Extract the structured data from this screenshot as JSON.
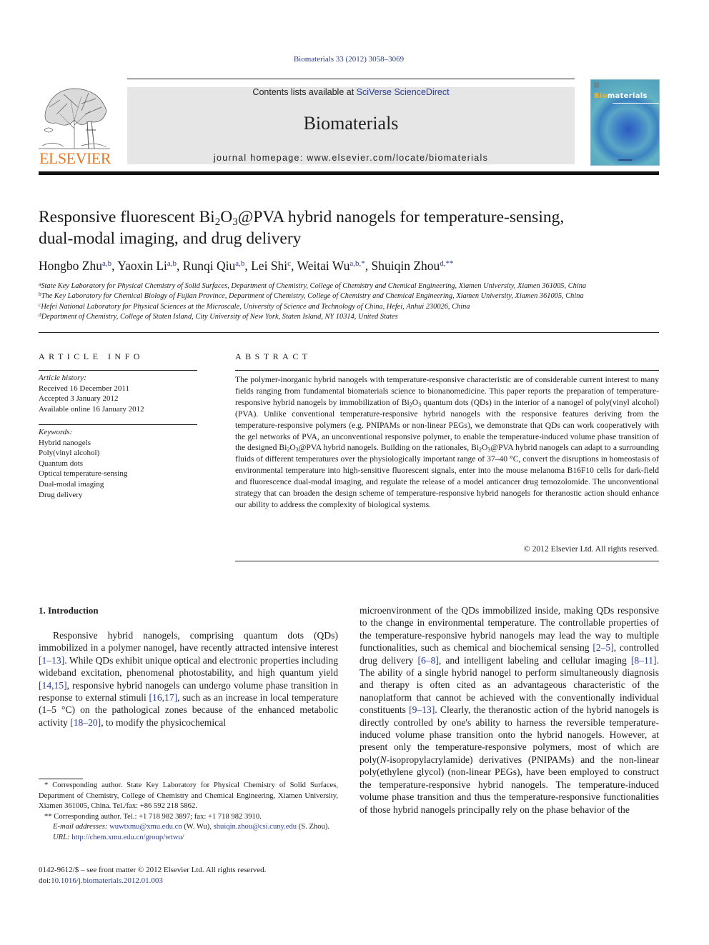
{
  "header": {
    "journal_ref": "Biomaterials 33 (2012) 3058–3069",
    "contents_prefix": "Contents lists available at ",
    "contents_link": "SciVerse ScienceDirect",
    "journal_title": "Biomaterials",
    "homepage": "journal homepage: www.elsevier.com/locate/biomaterials",
    "publisher_logo_text": "ELSEVIER",
    "cover": {
      "title_accent": "Bio",
      "title_rest": "materials"
    }
  },
  "article": {
    "title_part1": "Responsive fluorescent Bi",
    "title_sub1": "2",
    "title_part2": "O",
    "title_sub2": "3",
    "title_part3": "@PVA hybrid nanogels for temperature-sensing,",
    "title_line2": "dual-modal imaging, and drug delivery",
    "authors": [
      {
        "name": "Hongbo Zhu",
        "sup": "a,b"
      },
      {
        "name": "Yaoxin Li",
        "sup": "a,b"
      },
      {
        "name": "Runqi Qiu",
        "sup": "a,b"
      },
      {
        "name": "Lei Shi",
        "sup": "c"
      },
      {
        "name": "Weitai Wu",
        "sup": "a,b,*"
      },
      {
        "name": "Shuiqin Zhou",
        "sup": "d,**"
      }
    ],
    "affiliations": [
      {
        "key": "a",
        "text": "State Key Laboratory for Physical Chemistry of Solid Surfaces, Department of Chemistry, College of Chemistry and Chemical Engineering, Xiamen University, Xiamen 361005, China"
      },
      {
        "key": "b",
        "text": "The Key Laboratory for Chemical Biology of Fujian Province, Department of Chemistry, College of Chemistry and Chemical Engineering, Xiamen University, Xiamen 361005, China"
      },
      {
        "key": "c",
        "text": "Hefei National Laboratory for Physical Sciences at the Microscale, University of Science and Technology of China, Hefei, Anhui 230026, China"
      },
      {
        "key": "d",
        "text": "Department of Chemistry, College of Staten Island, City University of New York, Staten Island, NY 10314, United States"
      }
    ]
  },
  "article_info": {
    "heading": "ARTICLE INFO",
    "history_label": "Article history:",
    "history": [
      "Received 16 December 2011",
      "Accepted 3 January 2012",
      "Available online 16 January 2012"
    ],
    "keywords_label": "Keywords:",
    "keywords": [
      "Hybrid nanogels",
      "Poly(vinyl alcohol)",
      "Quantum dots",
      "Optical temperature-sensing",
      "Dual-modal imaging",
      "Drug delivery"
    ]
  },
  "abstract": {
    "heading": "ABSTRACT",
    "p1": "The polymer-inorganic hybrid nanogels with temperature-responsive characteristic are of considerable current interest to many fields ranging from fundamental biomaterials science to bionanomedicine. This paper reports the preparation of temperature-responsive hybrid nanogels by immobilization of Bi",
    "p2": "quantum dots (QDs) in the interior of a nanogel of poly(vinyl alcohol) (PVA). Unlike conventional temperature-responsive hybrid nanogels with the responsive features deriving from the temperature-responsive polymers (e.g. PNIPAMs or non-linear PEGs), we demonstrate that QDs can work cooperatively with the gel networks of PVA, an unconventional responsive polymer, to enable the temperature-induced volume phase transition of the designed Bi",
    "p3": "@PVA hybrid nanogels. Building on the rationales, Bi",
    "p4": "@PVA hybrid nanogels can adapt to a surrounding fluids of different temperatures over the physiologically important range of 37–40 °C, convert the disruptions in homeostasis of environmental temperature into high-sensitive fluorescent signals, enter into the mouse melanoma B16F10 cells for dark-field and fluorescence dual-modal imaging, and regulate the release of a model anticancer drug temozolomide. The unconventional strategy that can broaden the design scheme of temperature-responsive hybrid nanogels for theranostic action should enhance our ability to address the complexity of biological systems.",
    "copyright": "© 2012 Elsevier Ltd. All rights reserved."
  },
  "introduction": {
    "heading": "1.  Introduction",
    "left": [
      "Responsive hybrid nanogels, comprising quantum dots (QDs) immobilized in a polymer nanogel, have recently attracted intensive interest ",
      "[1–13]",
      ". While QDs exhibit unique optical and electronic properties including wideband excitation, phenomenal photostability, and high quantum yield ",
      "[14,15]",
      ", responsive hybrid nanogels can undergo volume phase transition in response to external stimuli ",
      "[16,17]",
      ", such as an increase in local temperature (1–5 °C) on the pathological zones because of the enhanced metabolic activity ",
      "[18–20]",
      ", to modify the physicochemical"
    ],
    "right": [
      "microenvironment of the QDs immobilized inside, making QDs responsive to the change in environmental temperature. The controllable properties of the temperature-responsive hybrid nanogels may lead the way to multiple functionalities, such as chemical and biochemical sensing ",
      "[2–5]",
      ", controlled drug delivery ",
      "[6–8]",
      ", and intelligent labeling and cellular imaging ",
      "[8–11]",
      ". The ability of a single hybrid nanogel to perform simultaneously diagnosis and therapy is often cited as an advantageous characteristic of the nanoplatform that cannot be achieved with the conventionally individual constituents ",
      "[9–13]",
      ". Clearly, the theranostic action of the hybrid nanogels is directly controlled by one's ability to harness the reversible temperature-induced volume phase transition onto the hybrid nanogels. However, at present only the temperature-responsive polymers, most of which are poly(",
      "N",
      "-isopropylacrylamide) derivatives (PNIPAMs) and the non-linear poly(ethylene glycol) (non-linear PEGs), have been employed to construct the temperature-responsive hybrid nanogels. The temperature-induced volume phase transition and thus the temperature-responsive functionalities of those hybrid nanogels principally rely on the phase behavior of the"
    ]
  },
  "footnotes": {
    "fn1_mark": "*",
    "fn1": "Corresponding author. State Key Laboratory for Physical Chemistry of Solid Surfaces, Department of Chemistry, College of Chemistry and Chemical Engineering, Xiamen University, Xiamen 361005, China. Tel./fax: +86 592 218 5862.",
    "fn2_mark": "**",
    "fn2": "Corresponding author. Tel.: +1 718 982 3897; fax: +1 718 982 3910.",
    "email_label": "E-mail addresses:",
    "email1": "wuwtxmu@xmu.edu.cn",
    "email1_who": " (W. Wu), ",
    "email2": "shuiqin.zhou@csi.cuny.edu",
    "email2_who": " (S. Zhou).",
    "url_label": "URL:",
    "url": "http://chem.xmu.edu.cn/group/wtwu/"
  },
  "front_matter": {
    "issn_line": "0142-9612/$ – see front matter © 2012 Elsevier Ltd. All rights reserved.",
    "doi_prefix": "doi:",
    "doi": "10.1016/j.biomaterials.2012.01.003"
  },
  "colors": {
    "link": "#2b3d8f",
    "elsevier_orange": "#e87722",
    "masthead_bg": "#e6e6e6"
  }
}
